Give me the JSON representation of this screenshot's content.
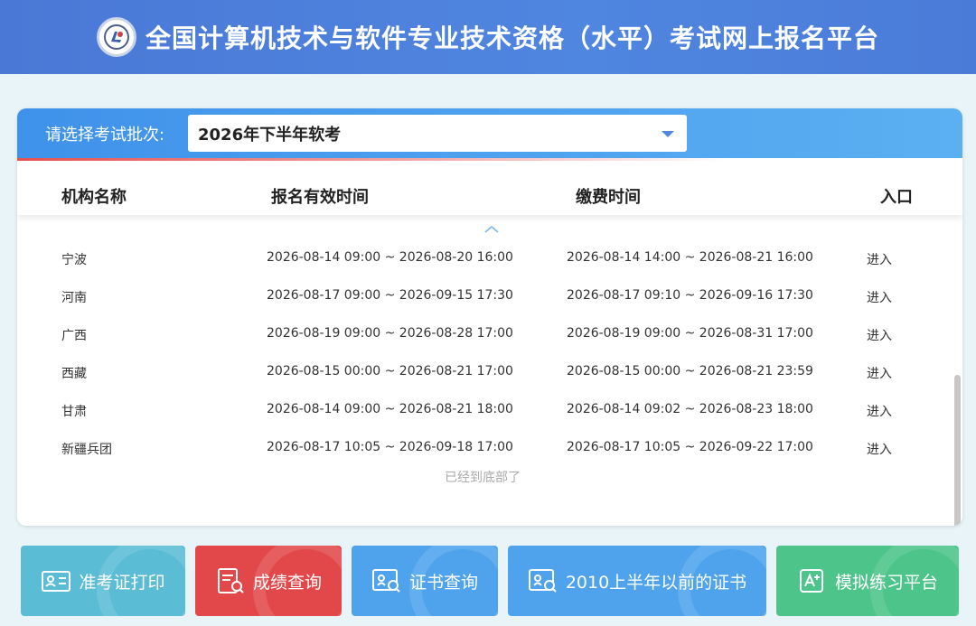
{
  "header": {
    "title": "全国计算机技术与软件专业技术资格（水平）考试网上报名平台"
  },
  "batch": {
    "label": "请选择考试批次:",
    "selected": "2026年下半年软考"
  },
  "table": {
    "columns": [
      "机构名称",
      "报名有效时间",
      "缴费时间",
      "入口"
    ],
    "rows": [
      {
        "org": "宁波",
        "reg": "2026-08-14 09:00 ~ 2026-08-20 16:00",
        "pay": "2026-08-14 14:00 ~ 2026-08-21 16:00",
        "entry": "进入"
      },
      {
        "org": "河南",
        "reg": "2026-08-17 09:00 ~ 2026-09-15 17:30",
        "pay": "2026-08-17 09:10 ~ 2026-09-16 17:30",
        "entry": "进入"
      },
      {
        "org": "广西",
        "reg": "2026-08-19 09:00 ~ 2026-08-28 17:00",
        "pay": "2026-08-19 09:00 ~ 2026-08-31 17:00",
        "entry": "进入"
      },
      {
        "org": "西藏",
        "reg": "2026-08-15 00:00 ~ 2026-08-21 17:00",
        "pay": "2026-08-15 00:00 ~ 2026-08-21 23:59",
        "entry": "进入"
      },
      {
        "org": "甘肃",
        "reg": "2026-08-14 09:00 ~ 2026-08-21 18:00",
        "pay": "2026-08-14 09:02 ~ 2026-08-23 18:00",
        "entry": "进入"
      },
      {
        "org": "新疆兵团",
        "reg": "2026-08-17 10:05 ~ 2026-09-18 17:00",
        "pay": "2026-08-17 10:05 ~ 2026-09-22 17:00",
        "entry": "进入"
      }
    ],
    "end_note": "已经到底部了"
  },
  "buttons": [
    {
      "label": "准考证打印",
      "color": "#5bbcd6",
      "icon": "id-card-icon"
    },
    {
      "label": "成绩查询",
      "color": "#e2484a",
      "icon": "document-search-icon"
    },
    {
      "label": "证书查询",
      "color": "#4ea3ec",
      "icon": "certificate-search-icon"
    },
    {
      "label": "2010上半年以前的证书",
      "color": "#4ea3ec",
      "icon": "certificate-search-icon"
    },
    {
      "label": "模拟练习平台",
      "color": "#4cc48a",
      "icon": "practice-icon"
    }
  ]
}
